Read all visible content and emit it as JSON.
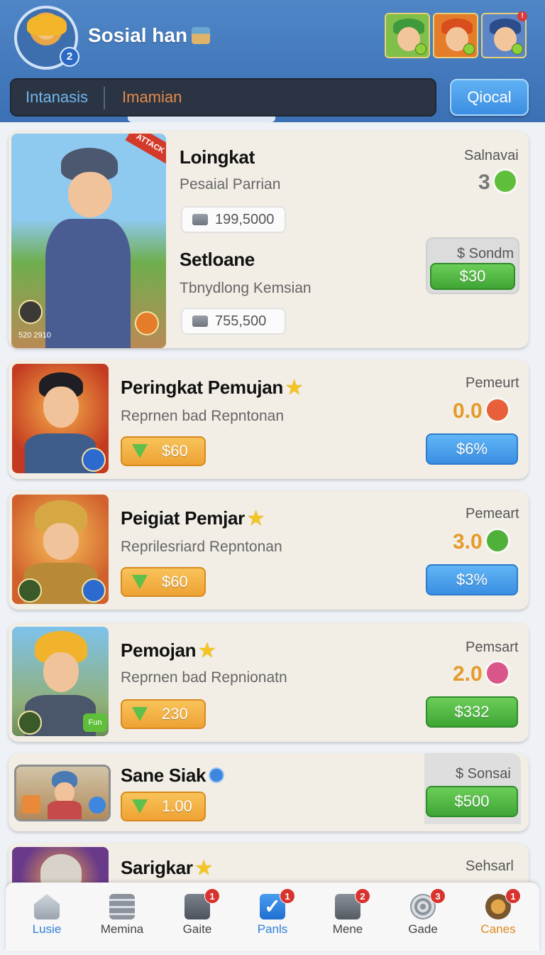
{
  "header": {
    "profile_level": "2",
    "title": "Sosial han",
    "friend_badge": "!"
  },
  "tabs": [
    {
      "label": "Intanasis"
    },
    {
      "label": "Imamian"
    }
  ],
  "local_button": "Qiocal",
  "featured": {
    "banner": "ATTACK",
    "thumb_caption": "520 2910",
    "title_1": "Loingkat",
    "subtitle_1": "Pesaial Parrian",
    "value_1": "199,5000",
    "title_2": "Setloane",
    "subtitle_2": "Tbnydlong Kemsian",
    "value_2": "755,500",
    "right_label": "Salnavai",
    "right_value": "3",
    "price_label": "$ Sondm",
    "price_button": "$30"
  },
  "cards": [
    {
      "title": "Peringkat Pemujan",
      "subtitle": "Reprnen bad Repntonan",
      "orange_value": "$60",
      "right_label": "Pemeurt",
      "right_value": "0.0",
      "value_color": "#e59a2a",
      "button_label": "$6%",
      "button_type": "blue"
    },
    {
      "title": "Peigiat Pemjar",
      "subtitle": "Reprilesriard Repntonan",
      "orange_value": "$60",
      "right_label": "Pemeart",
      "right_value": "3.0",
      "value_color": "#e59a2a",
      "button_label": "$3%",
      "button_type": "blue"
    },
    {
      "title": "Pemojan",
      "subtitle": "Reprnen bad Repnionatn",
      "orange_value": "230",
      "thumb_badge": "Fun",
      "right_label": "Pemsart",
      "right_value": "2.0",
      "value_color": "#e59a2a",
      "button_label": "$332",
      "button_type": "green"
    }
  ],
  "card5": {
    "title": "Sane Siak",
    "orange_value": "1.00",
    "price_label": "$ Sonsai",
    "button_label": "$500"
  },
  "card6": {
    "title": "Sarigkar",
    "right_label": "Sehsarl"
  },
  "bottom_nav": [
    {
      "label": "Lusie",
      "icon": "home-icon",
      "badge": "",
      "active": true
    },
    {
      "label": "Memina",
      "icon": "stack-icon",
      "badge": "",
      "active": false
    },
    {
      "label": "Gaite",
      "icon": "camera-icon",
      "badge": "1",
      "active": false
    },
    {
      "label": "Panls",
      "icon": "check-icon",
      "badge": "1",
      "active": true
    },
    {
      "label": "Mene",
      "icon": "box-icon",
      "badge": "2",
      "active": false
    },
    {
      "label": "Gade",
      "icon": "spiral-icon",
      "badge": "3",
      "active": false
    },
    {
      "label": "Canes",
      "icon": "cannon-icon",
      "badge": "1",
      "active": true
    }
  ],
  "colors": {
    "header": "#3b70b4",
    "accent_blue": "#3b8fe3",
    "accent_green": "#3ea535",
    "accent_orange": "#eea233",
    "nav_active_blue": "#2f7fd6",
    "nav_active_orange": "#e08a1e"
  }
}
